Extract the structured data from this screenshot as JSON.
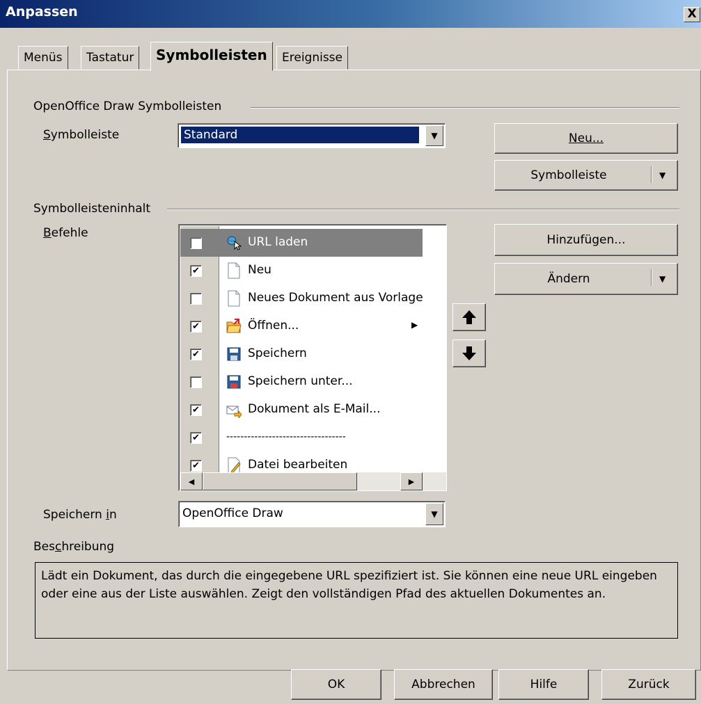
{
  "window": {
    "title": "Anpassen",
    "close": "X"
  },
  "tabs": [
    "Menüs",
    "Tastatur",
    "Symbolleisten",
    "Ereignisse"
  ],
  "toolbars_group": {
    "title": "OpenOffice Draw Symbolleisten",
    "toolbar_label": "Symbolleiste",
    "toolbar_value": "Standard",
    "new_button": "Neu...",
    "toolbar_menu_button": "Symbolleiste"
  },
  "content_group": {
    "title": "Symbolleisteninhalt",
    "commands_label": "Befehle",
    "add_button": "Hinzufügen...",
    "modify_button": "Ändern",
    "commands": [
      {
        "label": "URL laden",
        "checked": false,
        "selected": true,
        "icon": "load-url-icon"
      },
      {
        "label": "Neu",
        "checked": true,
        "icon": "new-document-icon"
      },
      {
        "label": "Neues Dokument aus Vorlage",
        "checked": false,
        "icon": "new-from-template-icon"
      },
      {
        "label": "Öffnen...",
        "checked": true,
        "icon": "open-folder-icon",
        "has_submenu": true
      },
      {
        "label": "Speichern",
        "checked": true,
        "icon": "save-icon"
      },
      {
        "label": "Speichern unter...",
        "checked": false,
        "icon": "save-as-icon"
      },
      {
        "label": "Dokument als E-Mail...",
        "checked": true,
        "icon": "email-document-icon"
      },
      {
        "label": "----------------------------------",
        "checked": true,
        "icon": "none"
      },
      {
        "label": "Datei bearbeiten",
        "checked": true,
        "icon": "edit-file-icon"
      }
    ]
  },
  "save_in": {
    "label": "Speichern in",
    "value": "OpenOffice Draw"
  },
  "description": {
    "label": "Beschreibung",
    "text": "Lädt ein Dokument, das durch die eingegebene URL spezifiziert ist. Sie können eine neue URL eingeben oder eine aus der Liste auswählen. Zeigt den vollständigen Pfad des aktuellen Dokumentes an."
  },
  "footer": {
    "ok": "OK",
    "cancel": "Abbrechen",
    "help": "Hilfe",
    "reset": "Zurück"
  }
}
